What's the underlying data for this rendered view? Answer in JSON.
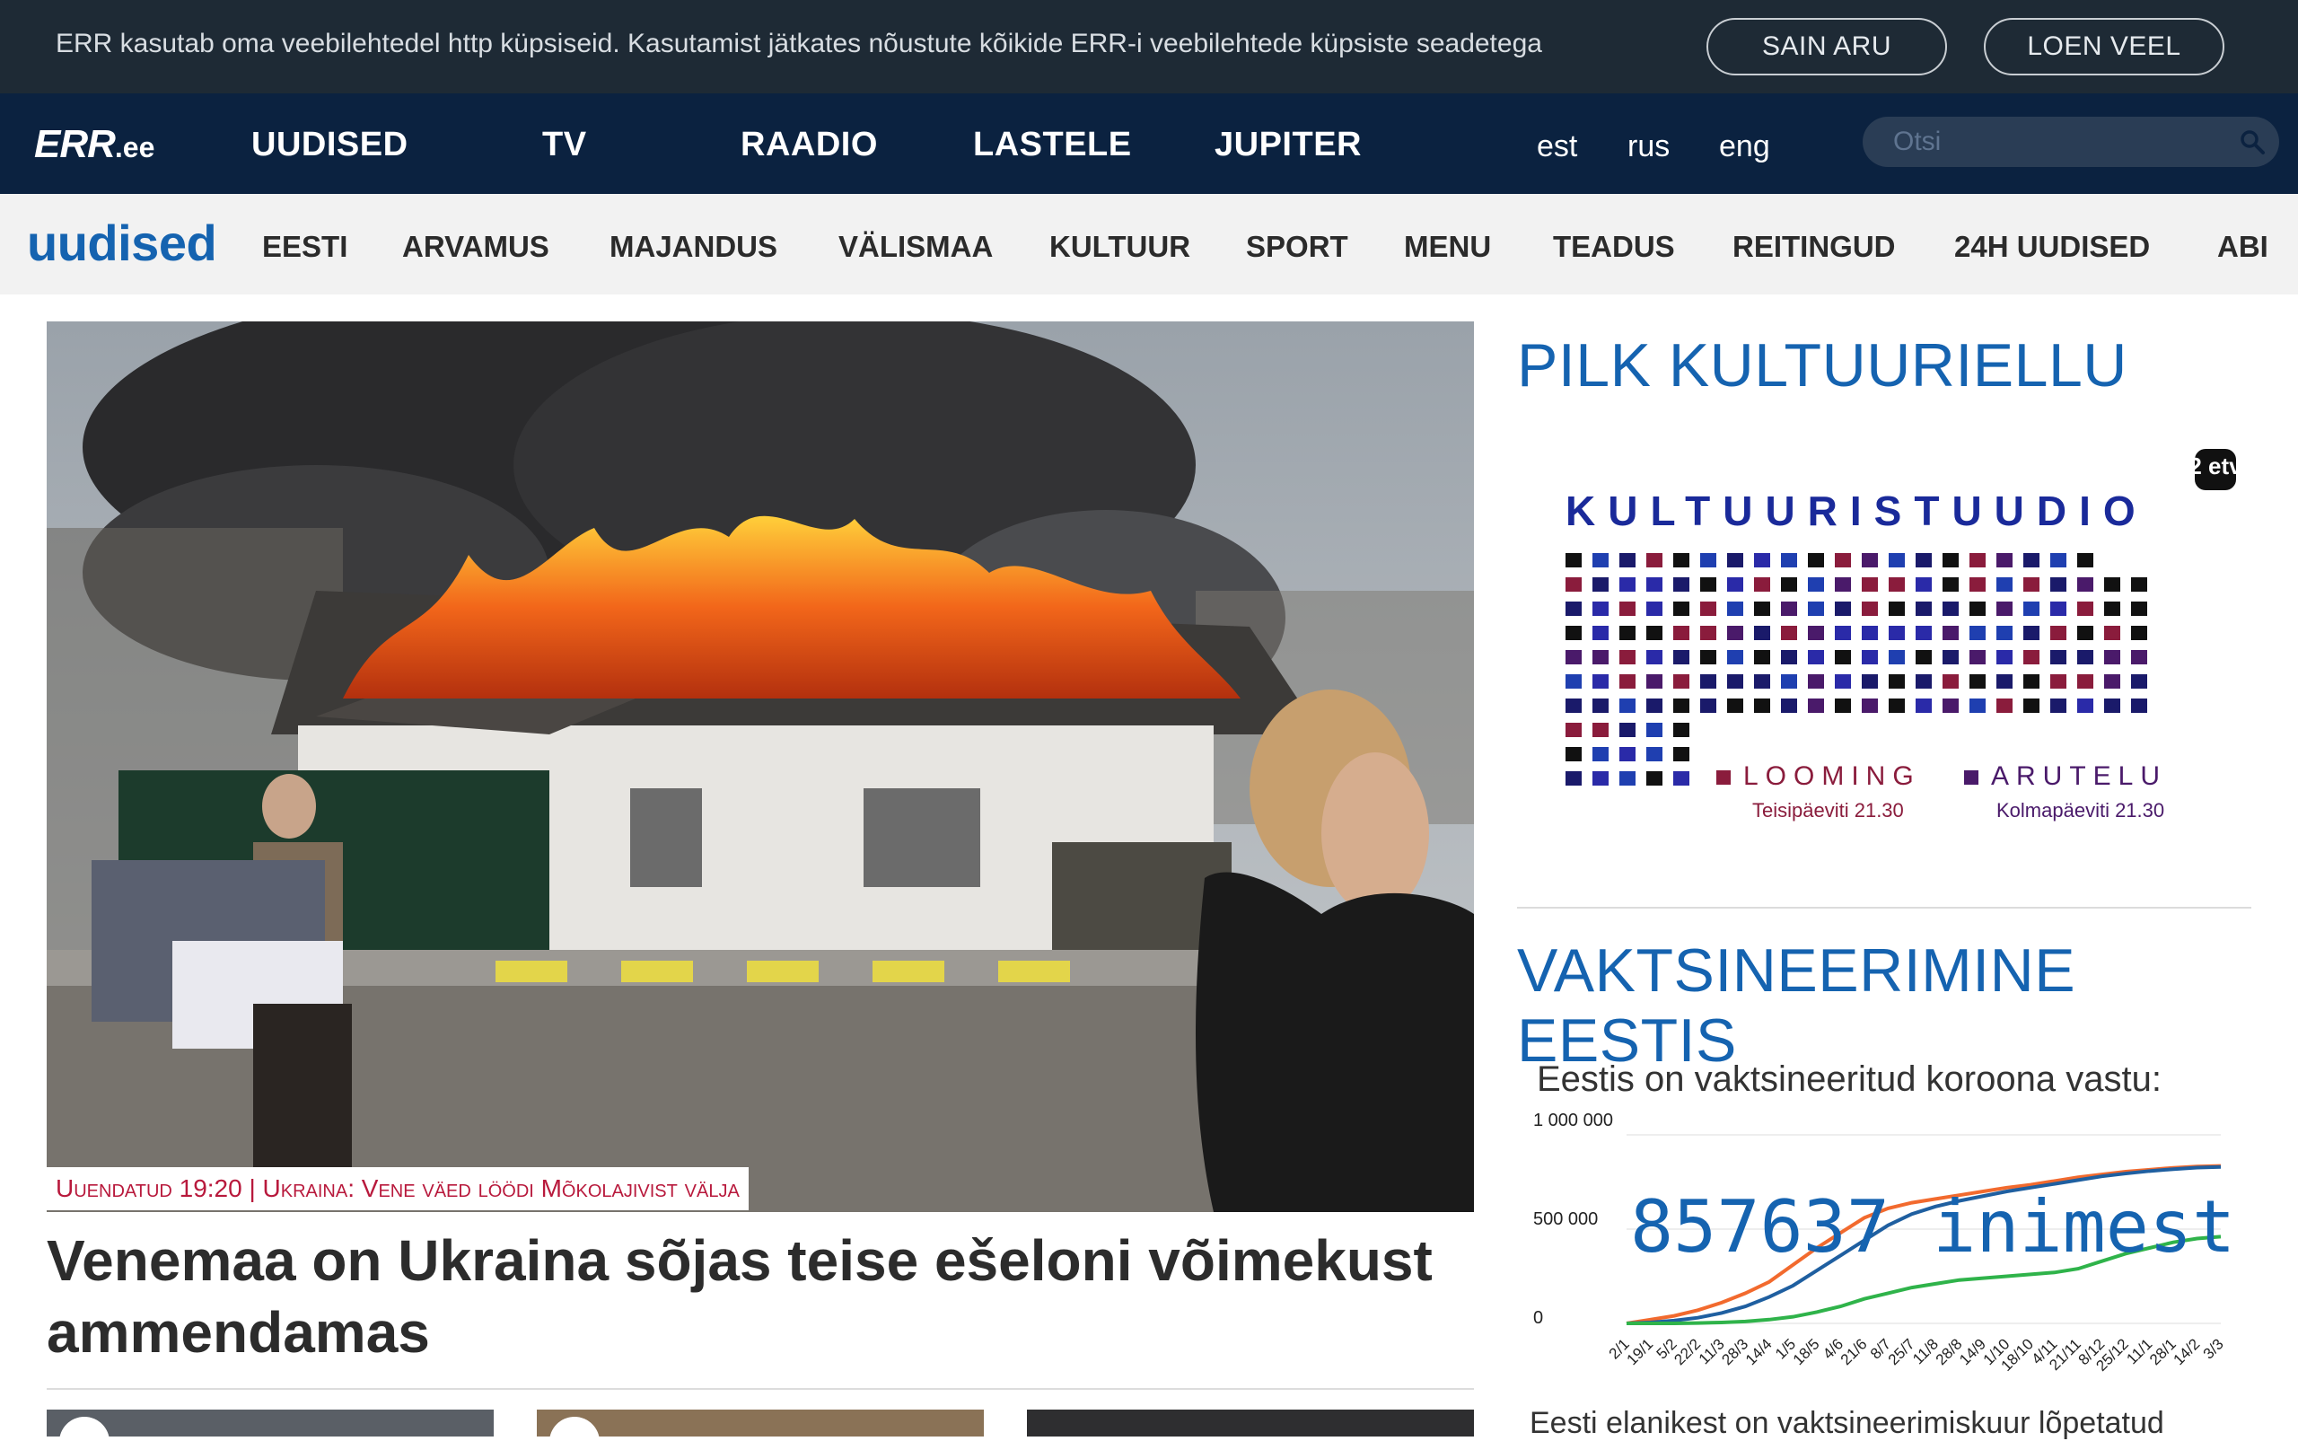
{
  "cookie": {
    "text": "ERR kasutab oma veebilehtedel http küpsiseid. Kasutamist jätkates nõustute kõikide ERR-i veebilehtede küpsiste seadetega",
    "agree_label": "SAIN ARU",
    "more_label": "LOEN VEEL"
  },
  "header": {
    "logo_main": "ERR",
    "logo_suffix": ".ee",
    "nav": [
      "UUDISED",
      "TV",
      "RAADIO",
      "LASTELE",
      "JUPITER"
    ],
    "languages": [
      "est",
      "rus",
      "eng"
    ],
    "search_placeholder": "Otsi"
  },
  "section": {
    "logo": "uudised",
    "items": [
      "EESTI",
      "ARVAMUS",
      "MAJANDUS",
      "VÄLISMAA",
      "KULTUUR",
      "SPORT",
      "MENU",
      "TEADUS",
      "REITINGUD",
      "24H UUDISED",
      "ABI"
    ]
  },
  "lead": {
    "caption": "Uuendatud 19:20 | Ukraina: Vene väed löödi Mõkolajivist välja",
    "headline": "Venemaa on Ukraina sõjas teise ešeloni võimekust ammendamas"
  },
  "sidebar": {
    "culture_title": "PILK KULTUURIELLU",
    "banner": {
      "channel": "2 etv",
      "title": "KULTUURISTUUDIO",
      "left_show": "LOOMING",
      "left_time": "Teisipäeviti 21.30",
      "right_show": "ARUTELU",
      "right_time": "Kolmapäeviti 21.30"
    },
    "vax_title": "VAKTSINEERIMINE EESTIS",
    "vax_subtitle": "Eestis on vaktsineeritud koroona vastu:",
    "vax_count": "857637 inimest",
    "vax_bottom": "Eesti elanikest on vaktsineerimiskuur lõpetatud"
  },
  "chart_data": {
    "type": "line",
    "ylim": [
      0,
      1000000
    ],
    "y_ticks": [
      "1 000 000",
      "500 000",
      "0"
    ],
    "x_ticks": [
      "2/1",
      "19/1",
      "5/2",
      "22/2",
      "11/3",
      "28/3",
      "14/4",
      "1/5",
      "18/5",
      "4/6",
      "21/6",
      "8/7",
      "25/7",
      "11/8",
      "28/8",
      "14/9",
      "1/10",
      "18/10",
      "4/11",
      "21/11",
      "8/12",
      "25/12",
      "11/1",
      "28/1",
      "14/2",
      "3/3"
    ],
    "series": [
      {
        "values": [
          0,
          20000,
          40000,
          70000,
          110000,
          160000,
          220000,
          310000,
          400000,
          480000,
          560000,
          610000,
          640000,
          660000,
          680000,
          700000,
          720000,
          735000,
          755000,
          775000,
          790000,
          805000,
          815000,
          825000,
          832000,
          835000
        ],
        "color": "#f26a2e"
      },
      {
        "values": [
          0,
          5000,
          15000,
          30000,
          55000,
          90000,
          140000,
          200000,
          280000,
          360000,
          440000,
          520000,
          580000,
          620000,
          650000,
          675000,
          700000,
          720000,
          740000,
          760000,
          780000,
          795000,
          808000,
          818000,
          826000,
          830000
        ],
        "color": "#1f5fa0"
      },
      {
        "values": [
          0,
          0,
          0,
          2000,
          5000,
          10000,
          20000,
          35000,
          60000,
          90000,
          130000,
          160000,
          190000,
          210000,
          230000,
          240000,
          250000,
          260000,
          270000,
          290000,
          330000,
          370000,
          400000,
          430000,
          450000,
          460000
        ],
        "color": "#2fb34a"
      }
    ]
  }
}
